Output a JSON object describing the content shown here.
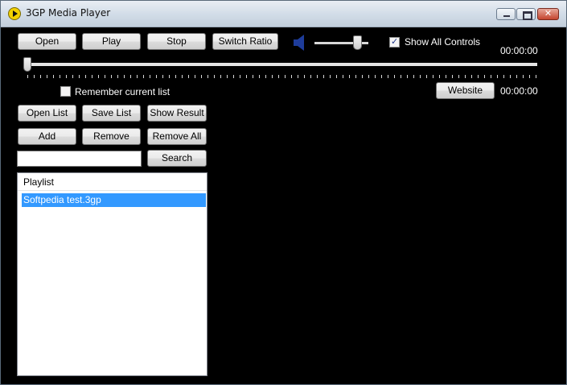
{
  "window": {
    "title": "3GP Media Player",
    "icon": "play-disc-icon",
    "controls": {
      "minimize": "minimize-icon",
      "maximize": "maximize-icon",
      "close": "✕"
    }
  },
  "toolbar": {
    "open_label": "Open",
    "play_label": "Play",
    "stop_label": "Stop",
    "switch_ratio_label": "Switch Ratio",
    "show_all_controls_label": "Show All Controls",
    "show_all_controls_checked": true,
    "volume_icon": "speaker-icon",
    "volume_level": 0.86
  },
  "timeline": {
    "elapsed": "00:00:00",
    "total": "00:00:00",
    "position": 0
  },
  "remember_label": "Remember current list",
  "remember_checked": false,
  "website_label": "Website",
  "list_buttons": {
    "open_list": "Open List",
    "save_list": "Save List",
    "show_result": "Show Result",
    "add": "Add",
    "remove": "Remove",
    "remove_all": "Remove All"
  },
  "search": {
    "value": "",
    "button_label": "Search"
  },
  "playlist": {
    "header": "Playlist",
    "items": [
      "Softpedia test.3gp"
    ],
    "selected_index": 0
  },
  "colors": {
    "video_background": "#000000",
    "selection": "#3399ff"
  }
}
